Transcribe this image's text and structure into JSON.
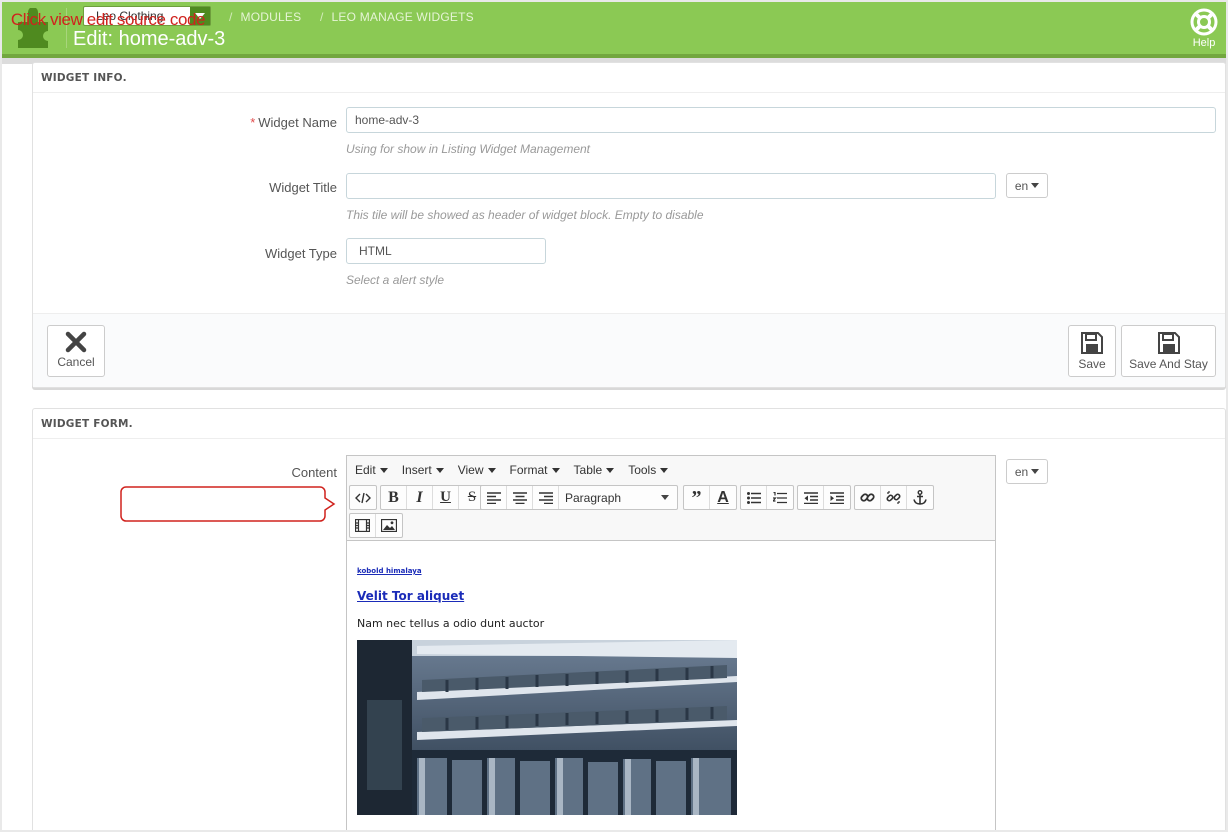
{
  "header": {
    "shop_select": "Leo Clothing",
    "breadcrumb": [
      "MODULES",
      "LEO MANAGE WIDGETS"
    ],
    "breadcrumb_sep": "/",
    "title": "Edit: home-adv-3",
    "help_label": "Help"
  },
  "widget_info": {
    "heading": "WIDGET INFO.",
    "name": {
      "required_mark": "*",
      "label": "Widget Name",
      "value": "home-adv-3",
      "hint": "Using for show in Listing Widget Management"
    },
    "title": {
      "label": "Widget Title",
      "value": "",
      "lang": "en",
      "hint": "This tile will be showed as header of widget block. Empty to disable"
    },
    "type": {
      "label": "Widget Type",
      "value": "HTML",
      "hint": "Select a alert style"
    },
    "footer": {
      "cancel": "Cancel",
      "save": "Save",
      "save_stay": "Save And Stay"
    }
  },
  "widget_form": {
    "heading": "WIDGET FORM.",
    "content_label": "Content",
    "lang": "en",
    "menus": [
      "Edit",
      "Insert",
      "View",
      "Format",
      "Table",
      "Tools"
    ],
    "format_select": "Paragraph",
    "content": {
      "small_link": "kobold himalaya",
      "heading_link": "Velit Tor aliquet",
      "paragraph": "Nam nec tellus a odio dunt auctor"
    }
  },
  "annotation": {
    "callout": "Click view edit source code",
    "color": "#d0221d"
  },
  "colors": {
    "header_green": "#8bc954",
    "link_blue": "#1a2bb8"
  }
}
